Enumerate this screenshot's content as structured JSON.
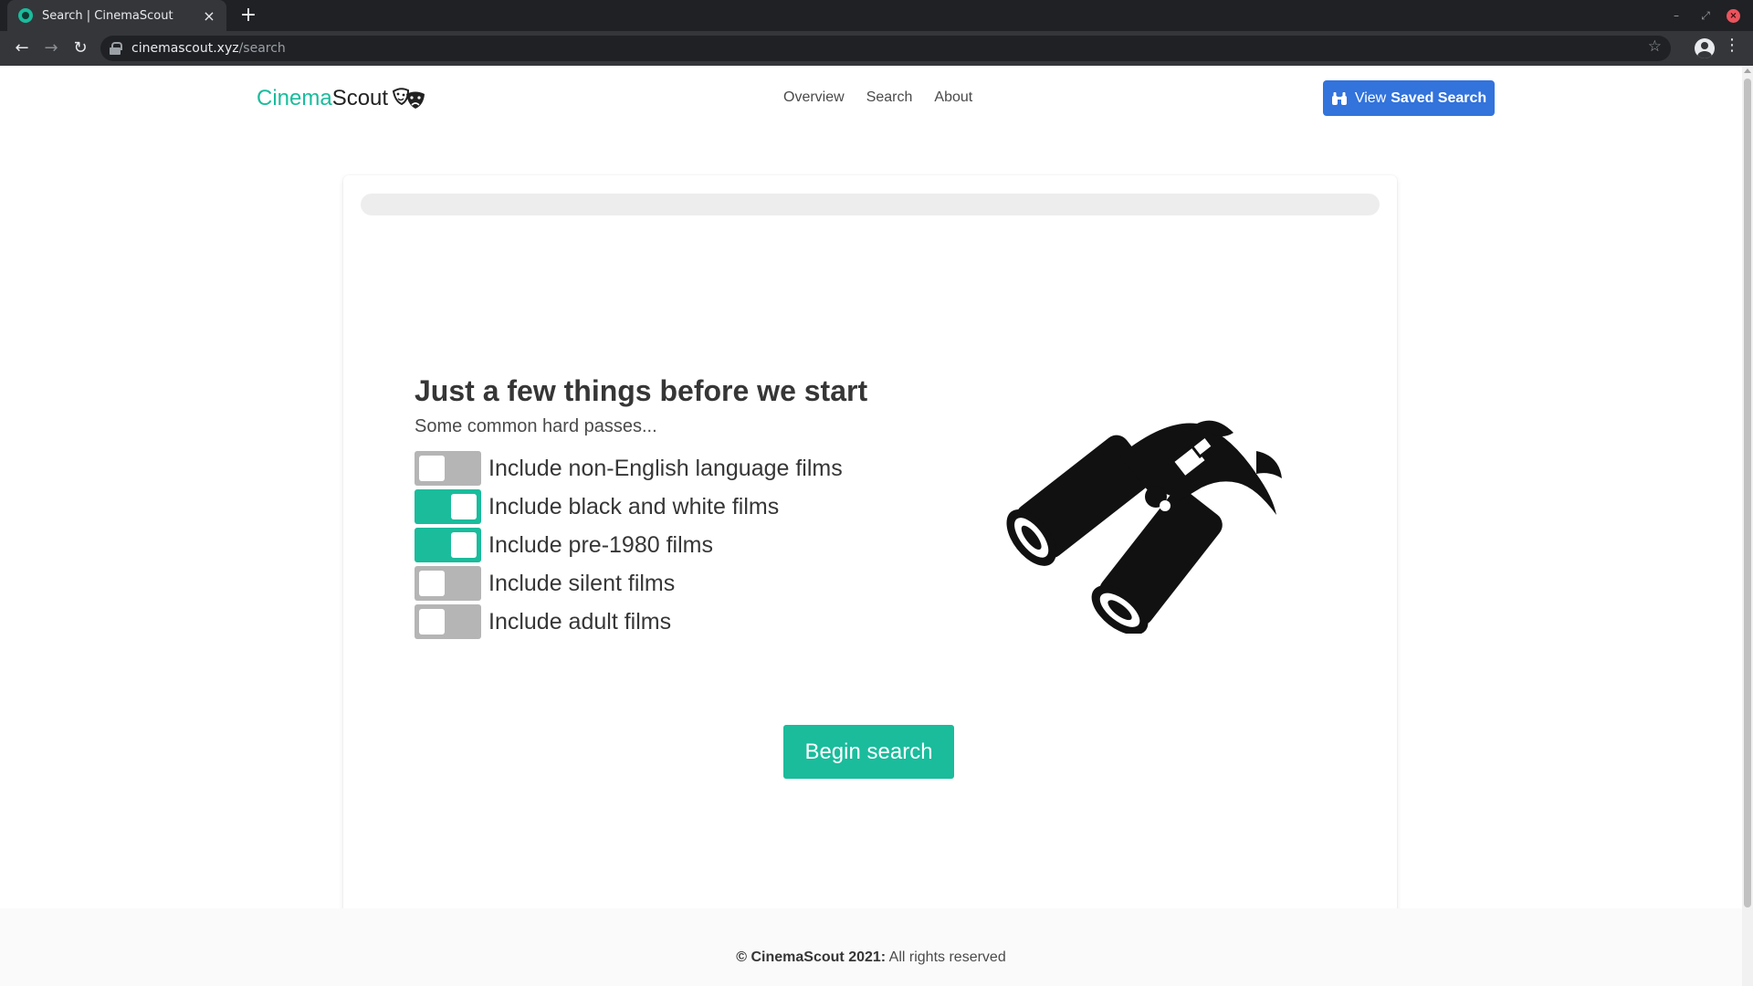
{
  "browser": {
    "tab_title": "Search | CinemaScout",
    "tab_close": "×",
    "new_tab": "+",
    "url_host": "cinemascout.xyz",
    "url_path": "/search",
    "icons": [
      "favicon-icon",
      "close-icon",
      "plus-icon",
      "back-icon",
      "forward-icon",
      "reload-icon",
      "lock-icon",
      "star-icon",
      "profile-icon",
      "kebab-menu-icon",
      "minimize-icon",
      "restore-icon",
      "window-close-icon"
    ]
  },
  "navbar": {
    "brand_part1": "Cinema",
    "brand_part2": "Scout",
    "links": [
      "Overview",
      "Search",
      "About"
    ],
    "saved_button_prefix": "View",
    "saved_button_bold": "Saved Search"
  },
  "search": {
    "progress": 0,
    "heading": "Just a few things before we start",
    "subheading": "Some common hard passes...",
    "toggles": [
      {
        "label": "Include non-English language films",
        "on": false
      },
      {
        "label": "Include black and white films",
        "on": true
      },
      {
        "label": "Include pre-1980 films",
        "on": true
      },
      {
        "label": "Include silent films",
        "on": false
      },
      {
        "label": "Include adult films",
        "on": false
      }
    ],
    "begin_button": "Begin search"
  },
  "footer": {
    "bold": "© CinemaScout 2021:",
    "text": "All rights reserved"
  },
  "colors": {
    "accent": "#1abc9c",
    "link_button": "#3273dc",
    "toggle_off": "#b5b5b5"
  }
}
